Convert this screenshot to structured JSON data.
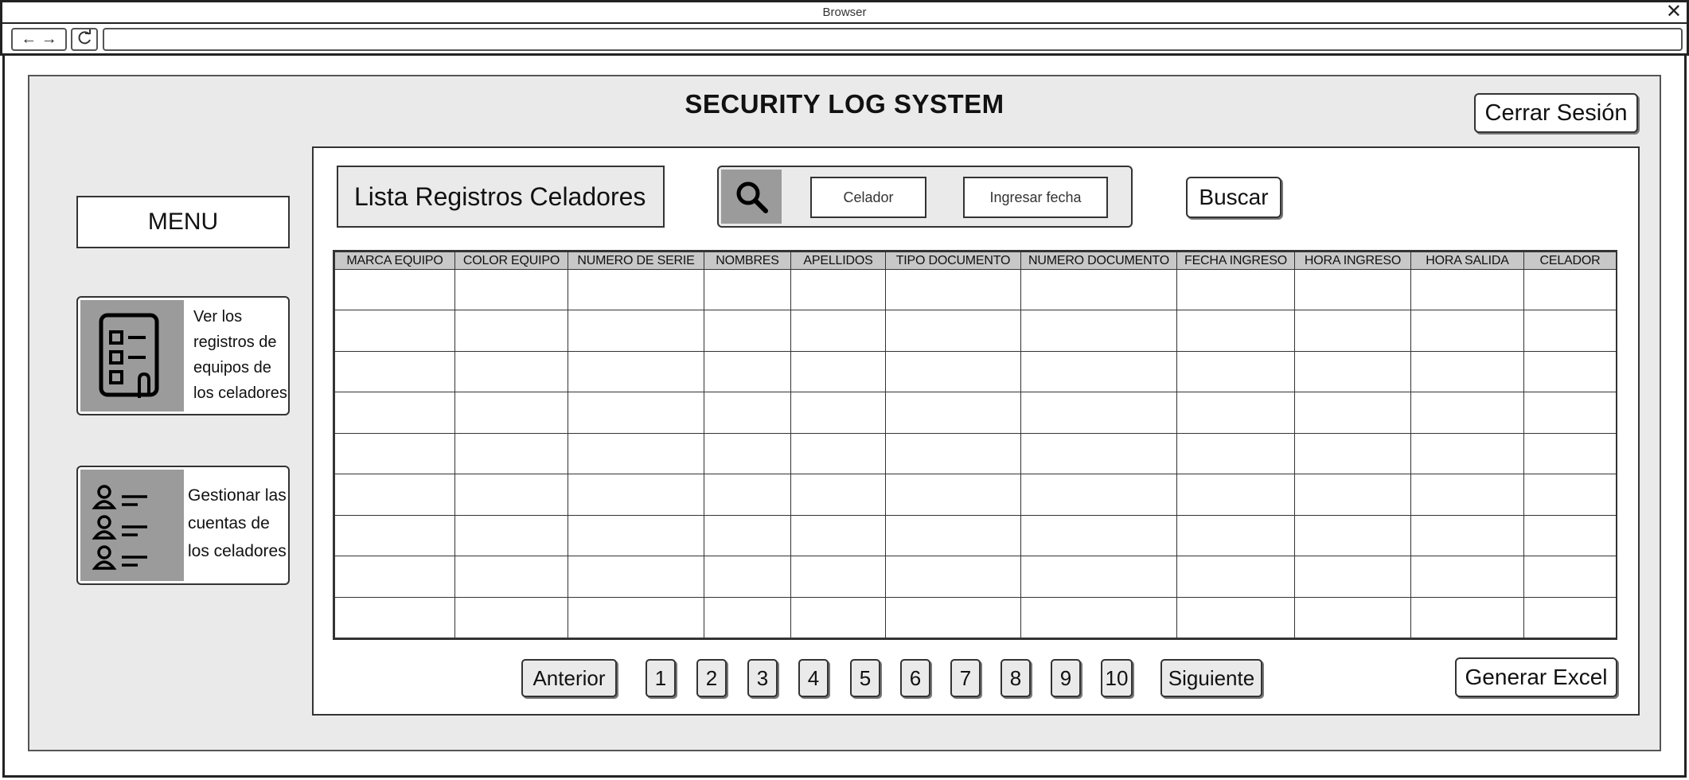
{
  "browser": {
    "title": "Browser",
    "nav_arrows": "← →",
    "reload_glyph": "C",
    "url": ""
  },
  "header": {
    "app_title": "SECURITY LOG SYSTEM",
    "logout_label": "Cerrar Sesión"
  },
  "sidebar": {
    "menu_label": "MENU",
    "cards": [
      {
        "label": "Ver los registros de equipos de los celadores",
        "icon": "checklist-icon"
      },
      {
        "label": "Gestionar las cuentas de los celadores",
        "icon": "user-list-icon"
      }
    ]
  },
  "main": {
    "section_title": "Lista Registros Celadores",
    "search": {
      "icon": "search-icon",
      "celador_placeholder": "Celador",
      "fecha_placeholder": "Ingresar fecha",
      "button_label": "Buscar"
    },
    "table": {
      "columns": [
        "MARCA EQUIPO",
        "COLOR EQUIPO",
        "NUMERO DE SERIE",
        "NOMBRES",
        "APELLIDOS",
        "TIPO DOCUMENTO",
        "NUMERO DOCUMENTO",
        "FECHA INGRESO",
        "HORA INGRESO",
        "HORA SALIDA",
        "CELADOR"
      ],
      "rows": [
        [
          "",
          "",
          "",
          "",
          "",
          "",
          "",
          "",
          "",
          "",
          ""
        ],
        [
          "",
          "",
          "",
          "",
          "",
          "",
          "",
          "",
          "",
          "",
          ""
        ],
        [
          "",
          "",
          "",
          "",
          "",
          "",
          "",
          "",
          "",
          "",
          ""
        ],
        [
          "",
          "",
          "",
          "",
          "",
          "",
          "",
          "",
          "",
          "",
          ""
        ],
        [
          "",
          "",
          "",
          "",
          "",
          "",
          "",
          "",
          "",
          "",
          ""
        ],
        [
          "",
          "",
          "",
          "",
          "",
          "",
          "",
          "",
          "",
          "",
          ""
        ],
        [
          "",
          "",
          "",
          "",
          "",
          "",
          "",
          "",
          "",
          "",
          ""
        ],
        [
          "",
          "",
          "",
          "",
          "",
          "",
          "",
          "",
          "",
          "",
          ""
        ],
        [
          "",
          "",
          "",
          "",
          "",
          "",
          "",
          "",
          "",
          "",
          ""
        ]
      ]
    },
    "pagination": {
      "prev_label": "Anterior",
      "pages": [
        "1",
        "2",
        "3",
        "4",
        "5",
        "6",
        "7",
        "8",
        "9",
        "10"
      ],
      "next_label": "Siguiente"
    },
    "excel_button_label": "Generar Excel"
  }
}
